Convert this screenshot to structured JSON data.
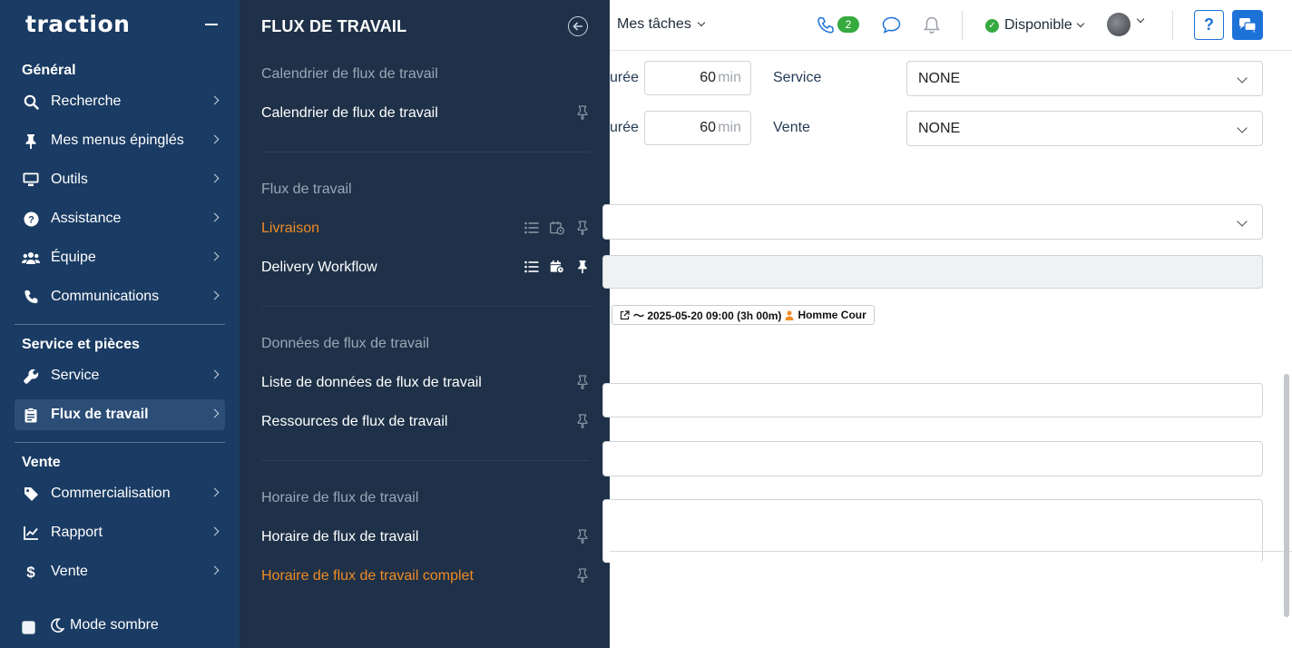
{
  "app": {
    "logo": "traction"
  },
  "sidebar": {
    "sections": [
      {
        "title": "Général",
        "items": [
          {
            "label": "Recherche",
            "icon": "search-icon"
          },
          {
            "label": "Mes menus épinglés",
            "icon": "pin-icon"
          },
          {
            "label": "Outils",
            "icon": "monitor-icon"
          },
          {
            "label": "Assistance",
            "icon": "help-circle-icon"
          },
          {
            "label": "Équipe",
            "icon": "team-icon"
          },
          {
            "label": "Communications",
            "icon": "phone-icon"
          }
        ]
      },
      {
        "title": "Service et pièces",
        "items": [
          {
            "label": "Service",
            "icon": "wrench-icon"
          },
          {
            "label": "Flux de travail",
            "icon": "clipboard-icon",
            "active": true
          }
        ]
      },
      {
        "title": "Vente",
        "items": [
          {
            "label": "Commercialisation",
            "icon": "tag-icon"
          },
          {
            "label": "Rapport",
            "icon": "chart-line-icon"
          },
          {
            "label": "Vente",
            "icon": "dollar-icon"
          }
        ]
      }
    ],
    "dark_mode_label": "Mode sombre"
  },
  "flyout": {
    "title": "FLUX DE TRAVAIL",
    "groups": [
      {
        "heading": "Calendrier de flux de travail",
        "items": [
          {
            "label": "Calendrier de flux de travail"
          }
        ]
      },
      {
        "heading": "Flux de travail",
        "items": [
          {
            "label": "Livraison",
            "highlight": true
          },
          {
            "label": "Delivery Workflow"
          }
        ]
      },
      {
        "heading": "Données de flux de travail",
        "items": [
          {
            "label": "Liste de données de flux de travail"
          },
          {
            "label": "Ressources de flux de travail"
          }
        ]
      },
      {
        "heading": "Horaire de flux de travail",
        "items": [
          {
            "label": "Horaire de flux de travail"
          },
          {
            "label": "Horaire de flux de travail complet",
            "highlight": true
          }
        ]
      }
    ],
    "accent_color": "#f08a24"
  },
  "topbar": {
    "my_tasks": "Mes tâches",
    "phone_badge": "2",
    "status": "Disponible",
    "help_label": "?"
  },
  "form": {
    "rows": [
      {
        "partial_label": "urée",
        "value": "60",
        "unit": "min",
        "side_label": "Service",
        "select_value": "NONE"
      },
      {
        "partial_label": "urée",
        "value": "60",
        "unit": "min",
        "side_label": "Vente",
        "select_value": "NONE"
      }
    ],
    "event_chip": {
      "text": "〜 2025-05-20 09:00 (3h 00m)",
      "person": "Homme Cour"
    }
  },
  "colors": {
    "sidebar_bg": "#1a3b63",
    "flyout_bg": "#1e3148",
    "primary": "#1d72d8",
    "success": "#36a93f"
  }
}
